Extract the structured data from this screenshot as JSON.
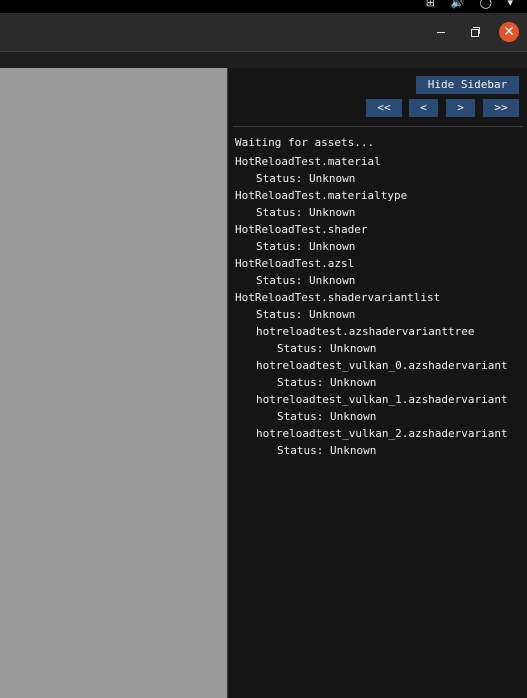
{
  "window": {
    "close_glyph": "✕"
  },
  "sidebar": {
    "hide_label": "Hide Sidebar",
    "nav": {
      "first": "<<",
      "prev": "<",
      "next": ">",
      "last": ">>"
    },
    "waiting_text": "Waiting for assets...",
    "assets": [
      {
        "text": "HotReloadTest.material",
        "level": 0
      },
      {
        "text": "Status: Unknown",
        "level": 1
      },
      {
        "text": "HotReloadTest.materialtype",
        "level": 0
      },
      {
        "text": "Status: Unknown",
        "level": 1
      },
      {
        "text": "HotReloadTest.shader",
        "level": 0
      },
      {
        "text": "Status: Unknown",
        "level": 1
      },
      {
        "text": "HotReloadTest.azsl",
        "level": 0
      },
      {
        "text": "Status: Unknown",
        "level": 1
      },
      {
        "text": "HotReloadTest.shadervariantlist",
        "level": 0
      },
      {
        "text": "Status: Unknown",
        "level": 1
      },
      {
        "text": "hotreloadtest.azshadervarianttree",
        "level": 1
      },
      {
        "text": "Status: Unknown",
        "level": 2
      },
      {
        "text": "hotreloadtest_vulkan_0.azshadervariant",
        "level": 1
      },
      {
        "text": "Status: Unknown",
        "level": 2
      },
      {
        "text": "hotreloadtest_vulkan_1.azshadervariant",
        "level": 1
      },
      {
        "text": "Status: Unknown",
        "level": 2
      },
      {
        "text": "hotreloadtest_vulkan_2.azshadervariant",
        "level": 1
      },
      {
        "text": "Status: Unknown",
        "level": 2
      }
    ]
  }
}
